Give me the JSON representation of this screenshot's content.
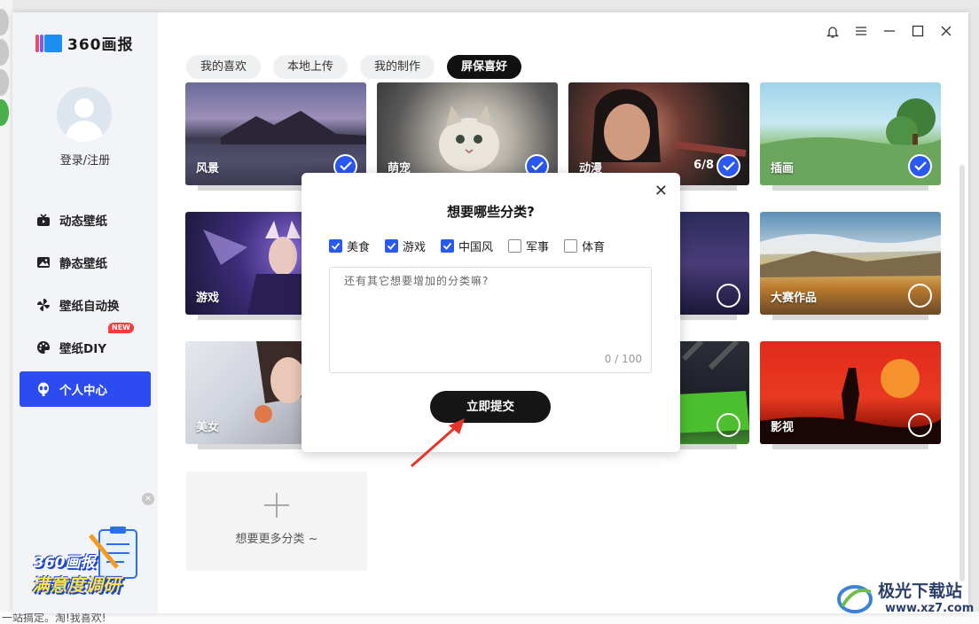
{
  "app": {
    "name": "360画报"
  },
  "window_controls": {
    "bell": "bell-icon",
    "menu": "menu-icon",
    "minimize": "minimize-icon",
    "maximize": "maximize-icon",
    "close": "close-icon"
  },
  "user": {
    "login_label": "登录/注册"
  },
  "sidebar": {
    "items": [
      {
        "label": "动态壁纸",
        "icon": "tv-icon"
      },
      {
        "label": "静态壁纸",
        "icon": "image-icon"
      },
      {
        "label": "壁纸自动换",
        "icon": "pinwheel-icon"
      },
      {
        "label": "壁纸DIY",
        "icon": "palette-icon",
        "badge": "NEW"
      },
      {
        "label": "个人中心",
        "icon": "alien-icon",
        "active": true
      }
    ],
    "survey_banner": {
      "line1": "360画报",
      "line2": "满意度调研"
    }
  },
  "tabs": [
    {
      "label": "我的喜欢"
    },
    {
      "label": "本地上传"
    },
    {
      "label": "我的制作"
    },
    {
      "label": "屏保喜好",
      "active": true
    }
  ],
  "categories": [
    {
      "label": "风景",
      "selected": true
    },
    {
      "label": "萌宠",
      "selected": true
    },
    {
      "label": "动漫",
      "selected": true,
      "counter": "6/8"
    },
    {
      "label": "插画",
      "selected": true
    },
    {
      "label": "游戏",
      "selected": false
    },
    {
      "label": "",
      "selected": false
    },
    {
      "label": "大赛作品",
      "selected": false
    },
    {
      "label": "美女",
      "selected": false
    },
    {
      "label": "",
      "selected": false
    },
    {
      "label": "影视",
      "selected": false
    }
  ],
  "more_card": {
    "label": "想要更多分类 ~"
  },
  "dialog": {
    "title": "想要哪些分类?",
    "options": [
      {
        "label": "美食",
        "checked": true
      },
      {
        "label": "游戏",
        "checked": true
      },
      {
        "label": "中国风",
        "checked": true
      },
      {
        "label": "军事",
        "checked": false
      },
      {
        "label": "体育",
        "checked": false
      }
    ],
    "textarea_placeholder": "还有其它想要增加的分类嘛?",
    "char_count": "0 / 100",
    "submit_label": "立即提交"
  },
  "background_text": {
    "bottom": "一站搞定。淘!我喜欢!"
  },
  "watermark": {
    "name": "极光下载站",
    "url": "www.xz7.com"
  },
  "colors": {
    "accent": "#2c4bf0",
    "check_blue": "#2a59f2",
    "dark_button": "#151515",
    "arrow_red": "#e8332a"
  }
}
